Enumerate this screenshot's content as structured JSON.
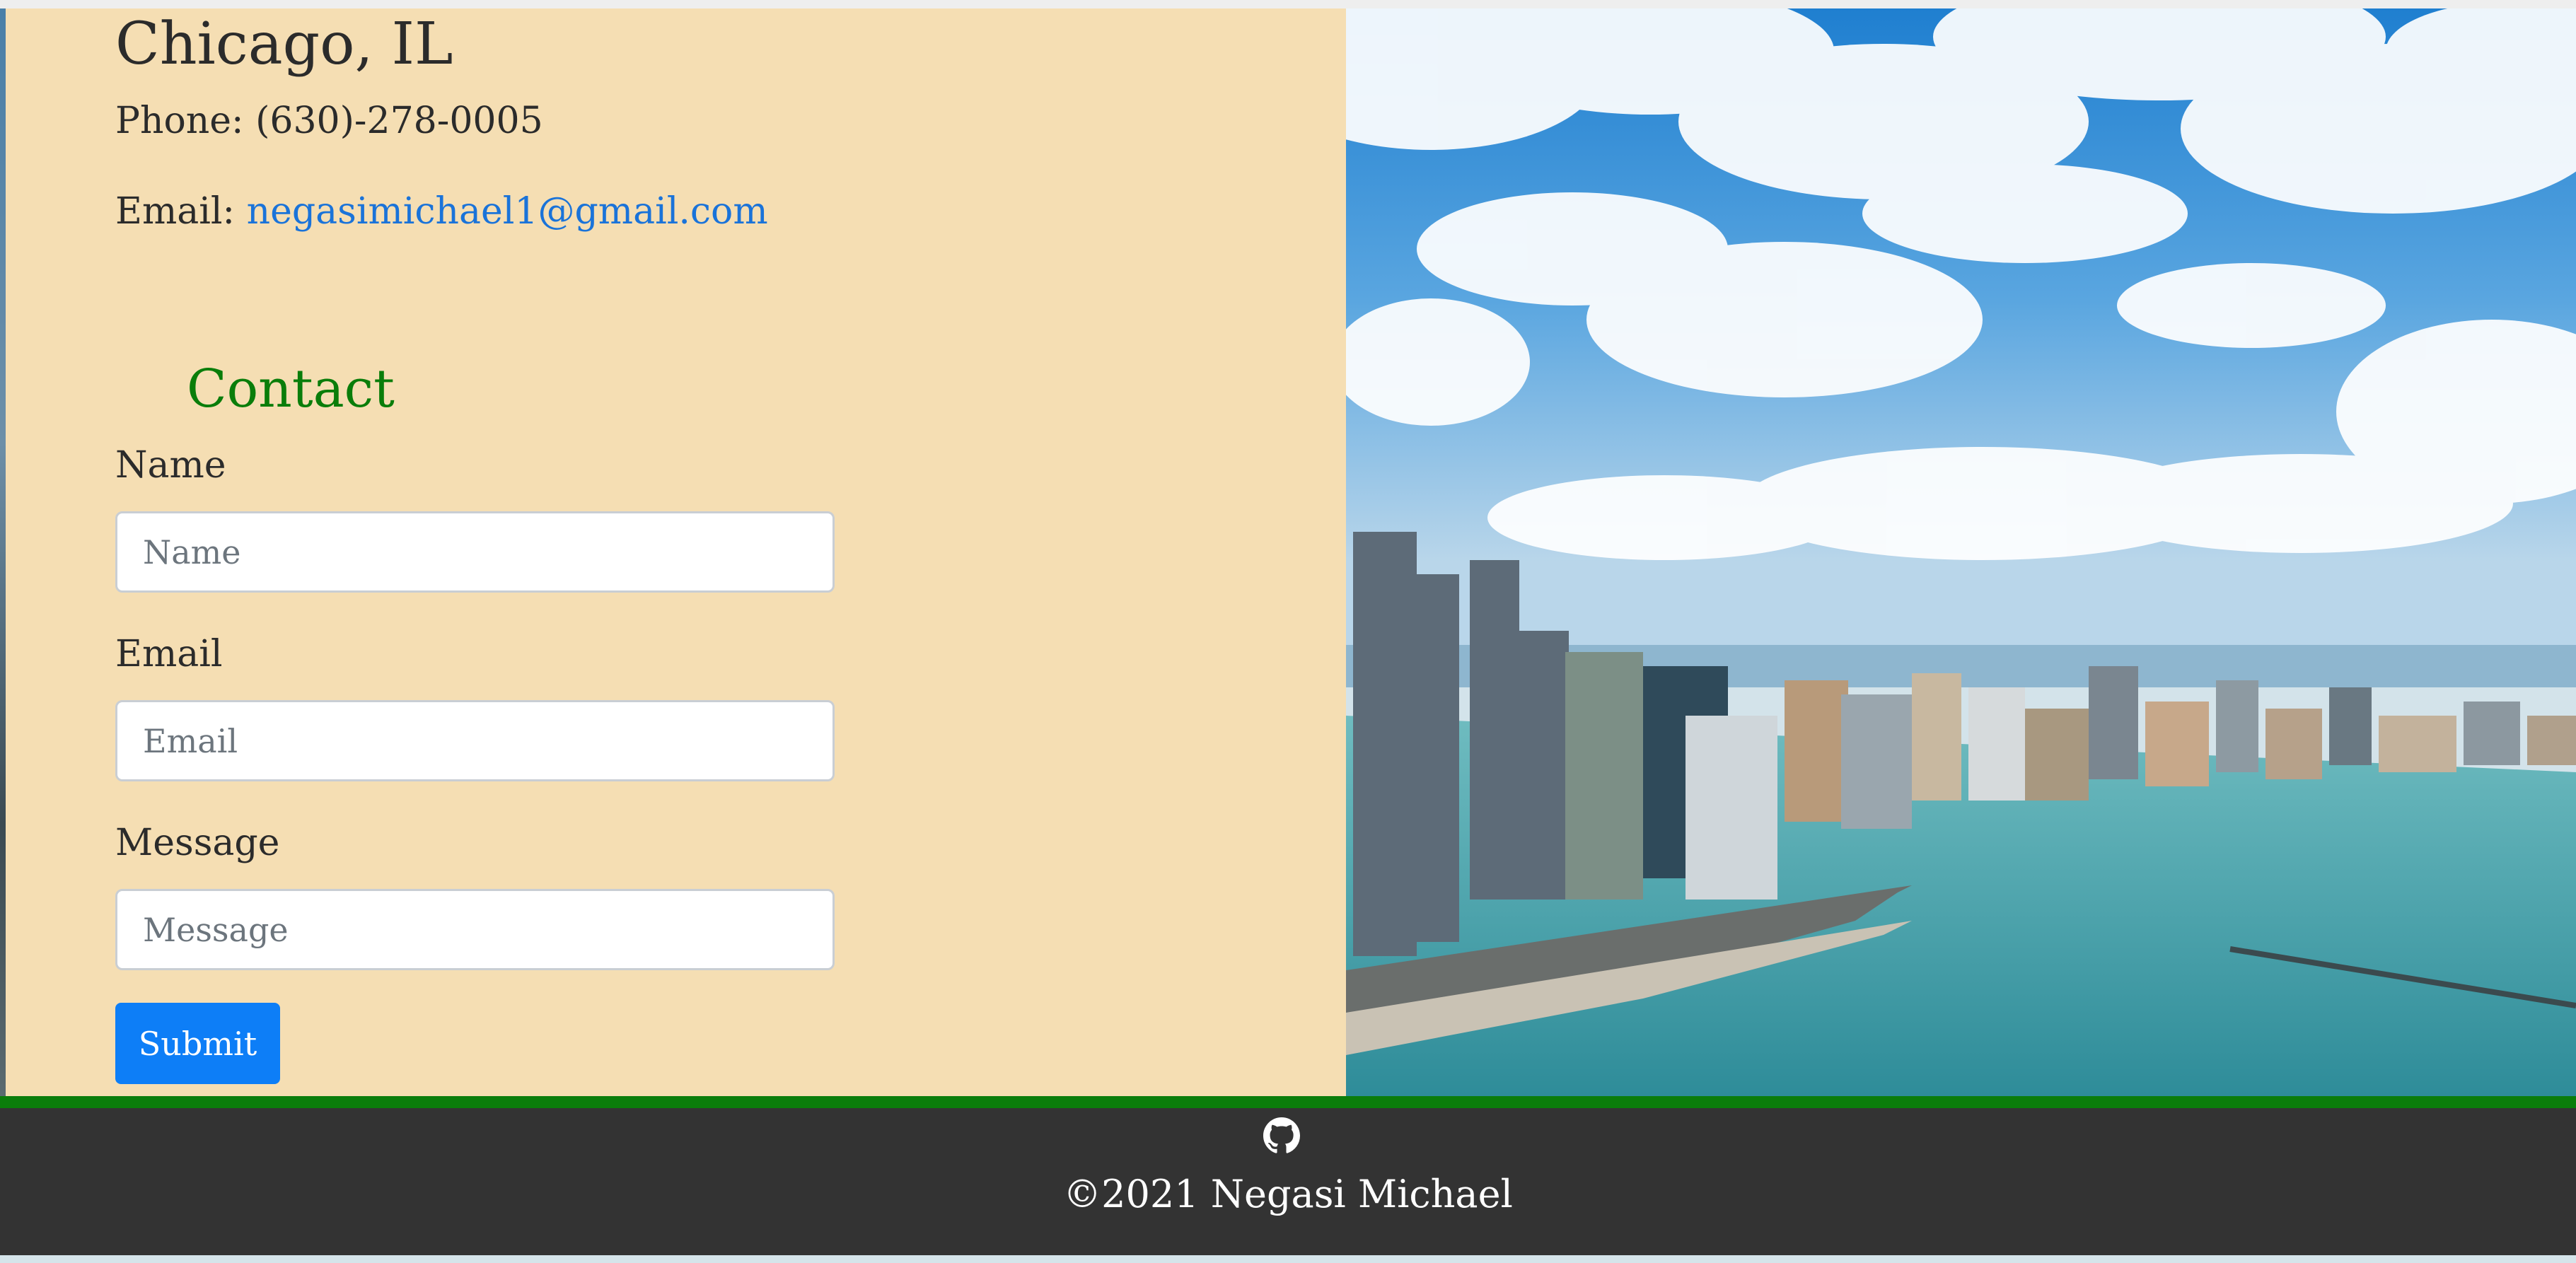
{
  "location": {
    "city": "Chicago, IL",
    "phone": "Phone: (630)-278-0005",
    "email_prefix": "Email: ",
    "email_link": "negasimichael1@gmail.com"
  },
  "contact": {
    "title": "Contact",
    "fields": [
      {
        "label": "Name",
        "placeholder": "Name"
      },
      {
        "label": "Email",
        "placeholder": "Email"
      },
      {
        "label": "Message",
        "placeholder": "Message"
      }
    ],
    "submit_label": "Submit"
  },
  "footer": {
    "icon": "github-icon",
    "copyright": "©2021 Negasi Michael"
  },
  "colors": {
    "panel_bg": "#f5deb3",
    "contact_title": "#0a7d0a",
    "link": "#1a73d9",
    "submit": "#0d7ef7",
    "footer_bg": "#333333",
    "footer_accent": "#0b7d0b"
  },
  "images": {
    "hero": "chicago-skyline-photo"
  }
}
